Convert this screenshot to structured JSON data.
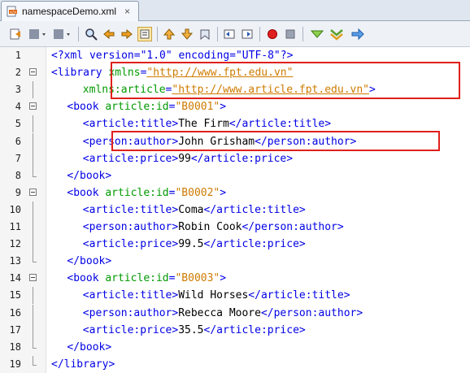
{
  "tab": {
    "title": "namespaceDemo.xml",
    "close": "×"
  },
  "toolbar": {
    "icons": [
      "last-edit-icon",
      "back-icon",
      "forward-icon",
      "find-selection-icon",
      "find-previous-icon",
      "find-next-icon",
      "toggle-highlight-icon",
      "previous-bookmark-icon",
      "next-bookmark-icon",
      "toggle-bookmark-icon",
      "shift-left-icon",
      "shift-right-icon",
      "record-macro-icon",
      "stop-macro-icon",
      "check-xml-icon",
      "validate-xml-icon",
      "xsl-transform-icon"
    ]
  },
  "lines": [
    {
      "num": "1",
      "indent": 0,
      "fold": "none",
      "parts": [
        [
          "pi",
          "<?xml version=\"1.0\" encoding=\"UTF-8\"?>"
        ]
      ]
    },
    {
      "num": "2",
      "indent": 0,
      "fold": "open",
      "parts": [
        [
          "tag",
          "<library "
        ],
        [
          "attr",
          "xmlns"
        ],
        [
          "tag",
          "="
        ],
        [
          "val",
          "\"http://www.fpt.edu.vn\""
        ]
      ]
    },
    {
      "num": "3",
      "indent": 8,
      "fold": "line",
      "parts": [
        [
          "attr",
          "xmlns:article"
        ],
        [
          "tag",
          "="
        ],
        [
          "val",
          "\"http://www.article.fpt.edu.vn\""
        ],
        [
          "tag",
          ">"
        ]
      ]
    },
    {
      "num": "4",
      "indent": 4,
      "fold": "open",
      "parts": [
        [
          "tag",
          "<book "
        ],
        [
          "attr",
          "article:id"
        ],
        [
          "tag",
          "="
        ],
        [
          "val",
          "\"B0001\""
        ],
        [
          "tag",
          ">"
        ]
      ]
    },
    {
      "num": "5",
      "indent": 8,
      "fold": "line",
      "parts": [
        [
          "tag",
          "<article:title>"
        ],
        [
          "txt",
          "The Firm"
        ],
        [
          "tag",
          "</article:title>"
        ]
      ]
    },
    {
      "num": "6",
      "indent": 8,
      "fold": "line",
      "parts": [
        [
          "tag",
          "<person:author>"
        ],
        [
          "txt",
          "John Grisham"
        ],
        [
          "tag",
          "</person:author>"
        ]
      ]
    },
    {
      "num": "7",
      "indent": 8,
      "fold": "line",
      "parts": [
        [
          "tag",
          "<article:price>"
        ],
        [
          "txt",
          "99"
        ],
        [
          "tag",
          "</article:price>"
        ]
      ]
    },
    {
      "num": "8",
      "indent": 4,
      "fold": "end",
      "parts": [
        [
          "tag",
          "</book>"
        ]
      ]
    },
    {
      "num": "9",
      "indent": 4,
      "fold": "open",
      "parts": [
        [
          "tag",
          "<book "
        ],
        [
          "attr",
          "article:id"
        ],
        [
          "tag",
          "="
        ],
        [
          "val",
          "\"B0002\""
        ],
        [
          "tag",
          ">"
        ]
      ]
    },
    {
      "num": "10",
      "indent": 8,
      "fold": "line",
      "parts": [
        [
          "tag",
          "<article:title>"
        ],
        [
          "txt",
          "Coma"
        ],
        [
          "tag",
          "</article:title>"
        ]
      ]
    },
    {
      "num": "11",
      "indent": 8,
      "fold": "line",
      "parts": [
        [
          "tag",
          "<person:author>"
        ],
        [
          "txt",
          "Robin Cook"
        ],
        [
          "tag",
          "</person:author>"
        ]
      ]
    },
    {
      "num": "12",
      "indent": 8,
      "fold": "line",
      "parts": [
        [
          "tag",
          "<article:price>"
        ],
        [
          "txt",
          "99.5"
        ],
        [
          "tag",
          "</article:price>"
        ]
      ]
    },
    {
      "num": "13",
      "indent": 4,
      "fold": "end",
      "parts": [
        [
          "tag",
          "</book>"
        ]
      ]
    },
    {
      "num": "14",
      "indent": 4,
      "fold": "open",
      "parts": [
        [
          "tag",
          "<book "
        ],
        [
          "attr",
          "article:id"
        ],
        [
          "tag",
          "="
        ],
        [
          "val",
          "\"B0003\""
        ],
        [
          "tag",
          ">"
        ]
      ]
    },
    {
      "num": "15",
      "indent": 8,
      "fold": "line",
      "parts": [
        [
          "tag",
          "<article:title>"
        ],
        [
          "txt",
          "Wild Horses"
        ],
        [
          "tag",
          "</article:title>"
        ]
      ]
    },
    {
      "num": "16",
      "indent": 8,
      "fold": "line",
      "parts": [
        [
          "tag",
          "<person:author>"
        ],
        [
          "txt",
          "Rebecca Moore"
        ],
        [
          "tag",
          "</person:author>"
        ]
      ]
    },
    {
      "num": "17",
      "indent": 8,
      "fold": "line",
      "parts": [
        [
          "tag",
          "<article:price>"
        ],
        [
          "txt",
          "35.5"
        ],
        [
          "tag",
          "</article:price>"
        ]
      ]
    },
    {
      "num": "18",
      "indent": 4,
      "fold": "end",
      "parts": [
        [
          "tag",
          "</book>"
        ]
      ]
    },
    {
      "num": "19",
      "indent": 0,
      "fold": "end",
      "parts": [
        [
          "tag",
          "</library>"
        ]
      ]
    }
  ]
}
